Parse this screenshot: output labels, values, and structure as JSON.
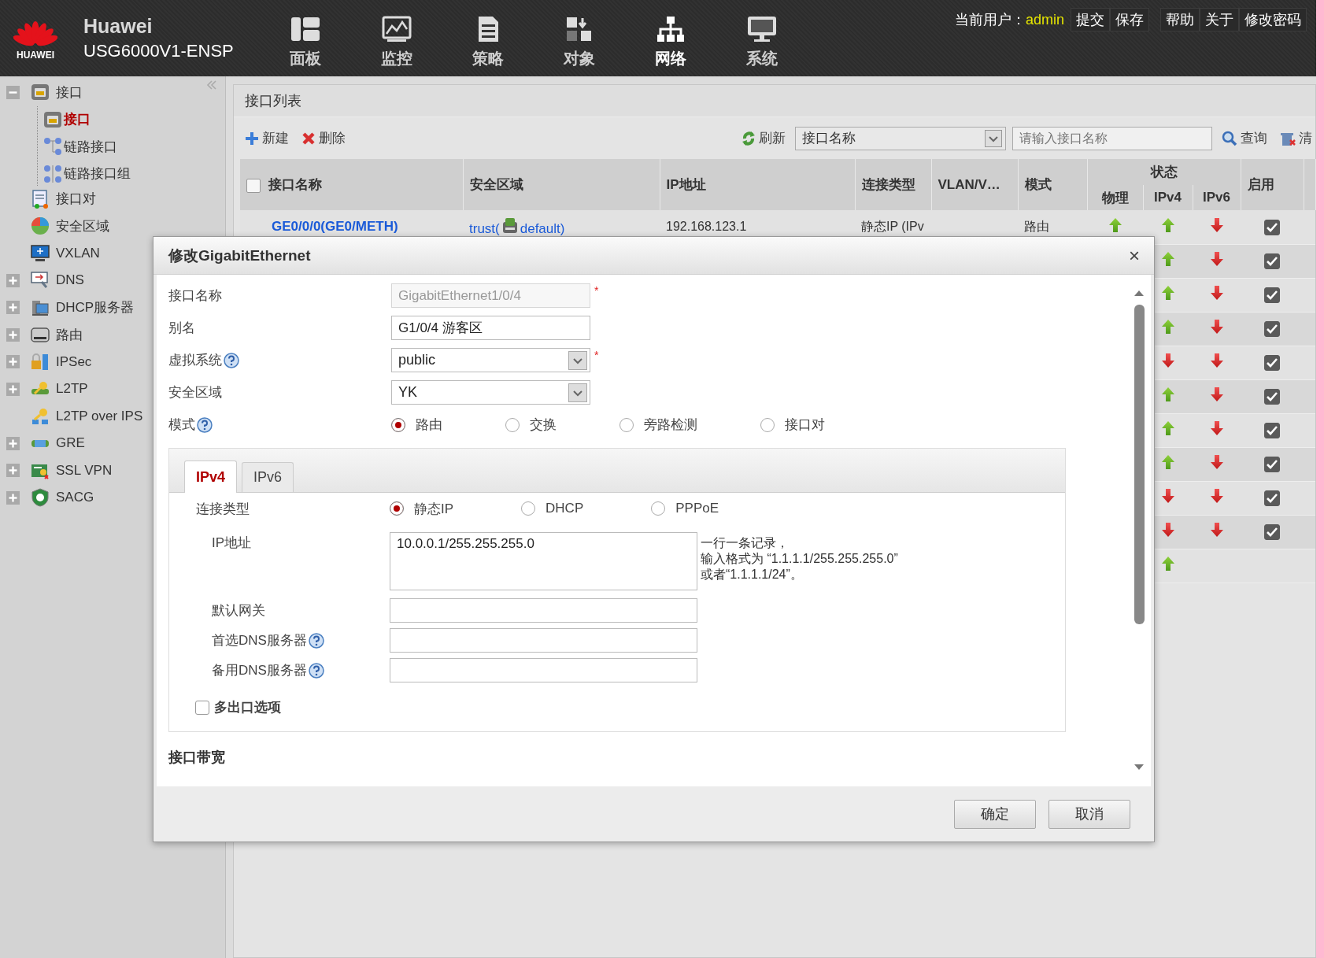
{
  "header": {
    "logo_text": "HUAWEI",
    "brand": "Huawei",
    "model": "USG6000V1-ENSP",
    "nav": [
      {
        "label": "面板",
        "selected": false
      },
      {
        "label": "监控",
        "selected": false
      },
      {
        "label": "策略",
        "selected": false
      },
      {
        "label": "对象",
        "selected": false
      },
      {
        "label": "网络",
        "selected": true
      },
      {
        "label": "系统",
        "selected": false
      }
    ],
    "user_label": "当前用户：",
    "user": "admin",
    "actions": [
      "提交",
      "保存"
    ],
    "links": [
      "帮助",
      "关于",
      "修改密码"
    ]
  },
  "sidebar": {
    "items": [
      {
        "label": "接口",
        "expanded": true,
        "selected": false,
        "children": [
          {
            "label": "接口",
            "selected": true
          },
          {
            "label": "链路接口",
            "selected": false
          },
          {
            "label": "链路接口组",
            "selected": false
          }
        ]
      },
      {
        "label": "接口对",
        "selected": false
      },
      {
        "label": "安全区域",
        "selected": false
      },
      {
        "label": "VXLAN",
        "selected": false
      },
      {
        "label": "DNS",
        "expanded": false,
        "selected": false
      },
      {
        "label": "DHCP服务器",
        "expanded": false,
        "selected": false
      },
      {
        "label": "路由",
        "expanded": false,
        "selected": false
      },
      {
        "label": "IPSec",
        "expanded": false,
        "selected": false
      },
      {
        "label": "L2TP",
        "expanded": false,
        "selected": false
      },
      {
        "label": "L2TP over IPS",
        "selected": false
      },
      {
        "label": "GRE",
        "expanded": false,
        "selected": false
      },
      {
        "label": "SSL VPN",
        "expanded": false,
        "selected": false
      },
      {
        "label": "SACG",
        "expanded": false,
        "selected": false
      }
    ]
  },
  "panel": {
    "title": "接口列表",
    "toolbar": {
      "add": "新建",
      "delete": "删除",
      "refresh": "刷新",
      "filter": "接口名称",
      "search": {
        "placeholder": "请输入接口名称"
      },
      "query": "查询",
      "clear": "清"
    },
    "table": {
      "select_all": false,
      "columns": [
        {
          "label": "接口名称"
        },
        {
          "label": "安全区域"
        },
        {
          "label": "IP地址"
        },
        {
          "label": "连接类型"
        },
        {
          "label": "VLAN/V…"
        },
        {
          "label": "模式"
        },
        {
          "label": "状态",
          "children": [
            {
              "label": "物理"
            },
            {
              "label": "IPv4"
            },
            {
              "label": "IPv6"
            }
          ]
        },
        {
          "label": "启用"
        }
      ],
      "rows": [
        {
          "name": "GE0/0/0(GE0/METH)",
          "zone": {
            "name": "trust(",
            "vsys": "default)"
          },
          "ip": "192.168.123.1",
          "conn_type": "静态IP (IPv",
          "mode": "路由",
          "physical_up": true,
          "ipv4_up": true,
          "ipv6_up": false,
          "enabled": true
        },
        {
          "ipv4_up": true,
          "ipv6_up": false,
          "enabled": true
        },
        {
          "ipv4_up": true,
          "ipv6_up": false,
          "enabled": true
        },
        {
          "ipv4_up": true,
          "ipv6_up": false,
          "enabled": true
        },
        {
          "ipv4_up": false,
          "ipv6_up": false,
          "enabled": true
        },
        {
          "ipv4_up": true,
          "ipv6_up": false,
          "enabled": true
        },
        {
          "ipv4_up": true,
          "ipv6_up": false,
          "enabled": true
        },
        {
          "ipv4_up": true,
          "ipv6_up": false,
          "enabled": true
        },
        {
          "ipv4_up": false,
          "ipv6_up": false,
          "enabled": true
        },
        {
          "ipv4_up": false,
          "ipv6_up": false,
          "enabled": true
        },
        {
          "ipv4_up": true
        }
      ]
    }
  },
  "dialog": {
    "title": "修改GigabitEthernet",
    "close": "×",
    "fields": [
      {
        "kind": "text",
        "label": "接口名称",
        "value": "GigabitEthernet1/0/4",
        "disabled": true,
        "help": false,
        "required_mark": "*"
      },
      {
        "kind": "text",
        "label": "别名",
        "value": "G1/0/4 游客区",
        "disabled": false,
        "help": false
      },
      {
        "kind": "select",
        "label": "虚拟系统",
        "value": "public",
        "help": true,
        "required_mark": "*"
      },
      {
        "kind": "select",
        "label": "安全区域",
        "value": "YK",
        "help": false
      },
      {
        "kind": "radio",
        "label": "模式",
        "help": true,
        "options": [
          {
            "label": "路由",
            "selected": true
          },
          {
            "label": "交换",
            "selected": false
          },
          {
            "label": "旁路检测",
            "selected": false
          },
          {
            "label": "接口对",
            "selected": false
          }
        ]
      }
    ],
    "tabs": [
      {
        "label": "IPv4",
        "selected": true
      },
      {
        "label": "IPv6",
        "selected": false
      }
    ],
    "tab_fields": [
      {
        "kind": "radio",
        "label": "连接类型",
        "help": false,
        "options": [
          {
            "label": "静态IP",
            "selected": true
          },
          {
            "label": "DHCP",
            "selected": false
          },
          {
            "label": "PPPoE",
            "selected": false
          }
        ]
      },
      {
        "kind": "textarea",
        "label": "IP地址",
        "help": false,
        "value": "10.0.0.1/255.255.255.0",
        "hint_lines": [
          "一行一条记录，",
          "输入格式为 “1.1.1.1/255.255.255.0”",
          "或者“1.1.1.1/24”。"
        ]
      },
      {
        "kind": "text",
        "label": "默认网关",
        "help": false,
        "disabled": false
      },
      {
        "kind": "text",
        "label": "首选DNS服务器",
        "help": true,
        "disabled": false
      },
      {
        "kind": "text",
        "label": "备用DNS服务器",
        "help": true,
        "disabled": false
      }
    ],
    "option": {
      "label": "多出口选项",
      "checked": false
    },
    "section": "接口带宽",
    "buttons": [
      "确定",
      "取消"
    ]
  }
}
